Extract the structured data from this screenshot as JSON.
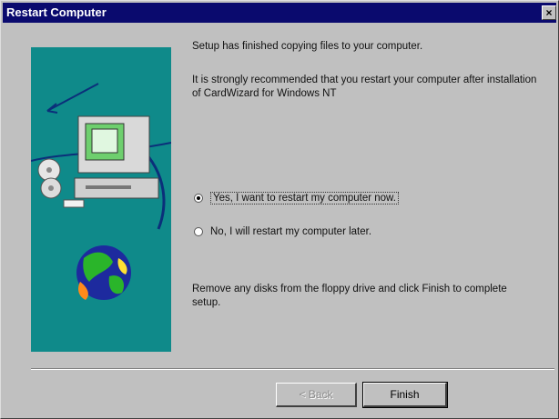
{
  "window": {
    "title": "Restart Computer",
    "close_label": "×"
  },
  "content": {
    "line1": "Setup has finished copying files to your computer.",
    "line2": "It is strongly recommended that you restart your computer after installation of CardWizard for Windows NT",
    "option_yes": "Yes, I want to restart my computer now.",
    "option_no": "No, I will restart my computer later.",
    "remove_note": "Remove any disks from the floppy drive and click Finish to complete setup."
  },
  "buttons": {
    "back": "< Back",
    "finish": "Finish"
  },
  "colors": {
    "title_bar": "#0a0a6e",
    "illustration_bg": "#0f8a8a",
    "window_bg": "#c0c0c0"
  }
}
